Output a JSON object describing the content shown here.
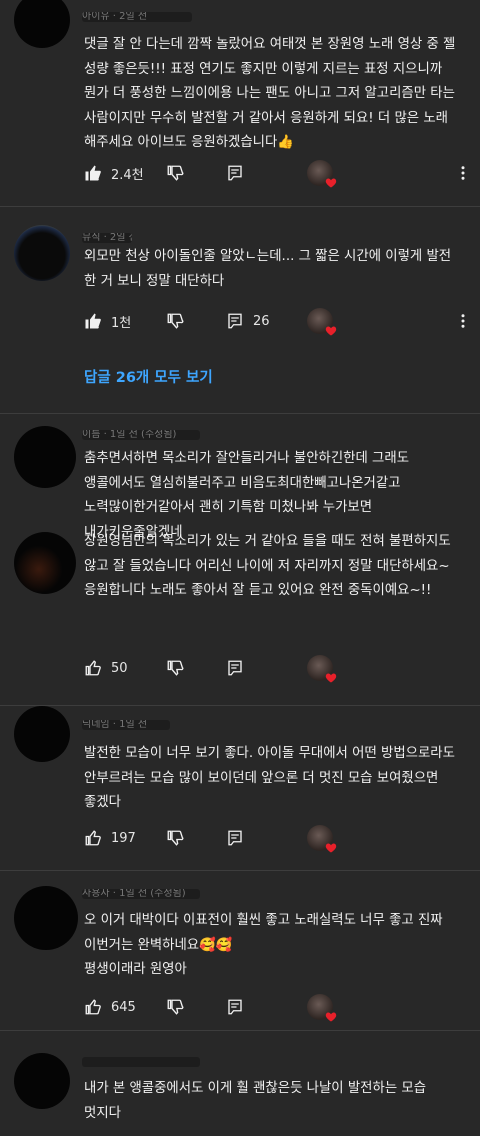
{
  "comments": [
    {
      "author": "아이유 · 2일 전",
      "text": "댓글 잘 안 다는데 깜짝 놀랐어요 여태껏 본 장원영 노래 영상 중 젤 성량 좋은듯!!! 표정 연기도 좋지만 이렇게 지르는 표정 지으니까 뭔가 더 풍성한 느낌이에용 나는 팬도 아니고 그저 알고리즘만 타는 사람이지만 무수히 발전할 거 같아서 응원하게 되요! 더 많은 노래 해주세요 아이브도 응원하겠습니다👍",
      "likes": "2.4천",
      "replies": "",
      "liked": true
    },
    {
      "author": "뮤직 · 2일 전",
      "text": "외모만 천상 아이돌인줄 알았ㄴ는데... 그 짧은 시간에 이렇게 발전 한 거 보니 정말 대단하다",
      "likes": "1천",
      "replies": "26",
      "liked": true,
      "view_replies": "답글 26개 모두 보기"
    },
    {
      "author": "이름 · 1일 전 (수정됨)",
      "text": "춤추면서하면 목소리가 잘안들리거나 불안하긴한데 그래도 앵콜에서도 열심히불러주고 비음도최대한빼고나온거같고 노력많이한거같아서 괜히 기특함 미쳤나봐 누가보면 내가키운줄알겠네",
      "likes": "",
      "replies": "",
      "liked": false
    },
    {
      "author": "",
      "text": "장원영님만의 목소리가 있는 거 같아요 들을 때도 전혀 불편하지도 않고 잘 들었습니다 어리신 나이에 저 자리까지 정말 대단하세요~ 응원합니다 노래도 좋아서 잘 듣고 있어요 완전 중독이예요~!!",
      "likes": "50",
      "replies": "",
      "liked": false
    },
    {
      "author": "닉네임 · 1일 전",
      "text": "발전한 모습이 너무 보기 좋다. 아이돌 무대에서 어떤 방법으로라도 안부르려는 모습 많이 보이던데 앞으론 더 멋진 모습 보여줬으면 좋겠다",
      "likes": "197",
      "replies": "",
      "liked": false
    },
    {
      "author": "사용자 · 1일 전 (수정됨)",
      "text": "오 이거 대박이다 이표전이 훨씬 좋고 노래실력도 너무 좋고 진짜 이번거는 완벽하네요🥰🥰\n평생이래라 원영아",
      "likes": "645",
      "replies": "",
      "liked": false
    },
    {
      "author": "",
      "text": "내가 본 앵콜중에서도 이게 훨 괜찮은듯 나날이 발전하는 모습 멋지다",
      "likes": "",
      "replies": "",
      "liked": false
    }
  ]
}
